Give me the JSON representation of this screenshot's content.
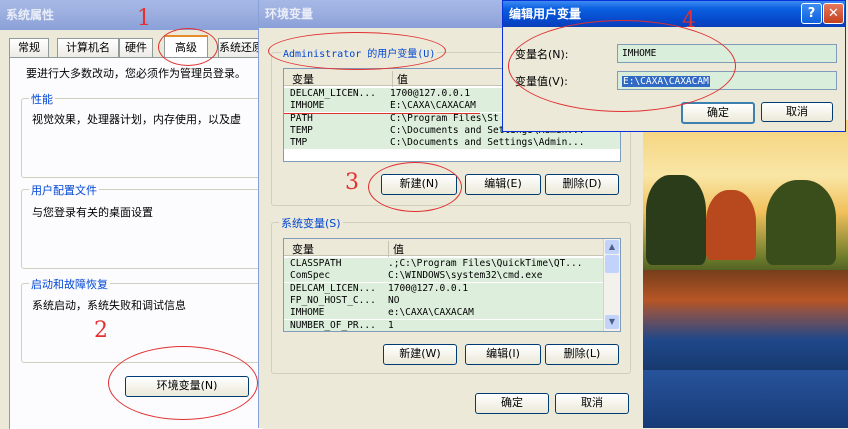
{
  "sys_props": {
    "title": "系统属性",
    "tabs": [
      "常规",
      "计算机名",
      "硬件",
      "高级",
      "系统还原"
    ],
    "intro": "要进行大多数改动，您必须作为管理员登录。",
    "perf": {
      "label": "性能",
      "text": "视觉效果，处理器计划，内存使用，以及虚"
    },
    "profile": {
      "label": "用户配置文件",
      "text": "与您登录有关的桌面设置"
    },
    "startup": {
      "label": "启动和故障恢复",
      "text": "系统启动，系统失败和调试信息"
    },
    "env_button": "环境变量(N)"
  },
  "env_vars": {
    "title": "环境变量",
    "user_group_label": "Administrator 的用户变量(U)",
    "col_var": "变量",
    "col_val": "值",
    "user_rows": [
      {
        "name": "DELCAM_LICEN...",
        "value": "1700@127.0.0.1"
      },
      {
        "name": "IMHOME",
        "value": "E:\\CAXA\\CAXACAM"
      },
      {
        "name": "PATH",
        "value": "C:\\Program Files\\St"
      },
      {
        "name": "TEMP",
        "value": "C:\\Documents and Settings\\Admin..."
      },
      {
        "name": "TMP",
        "value": "C:\\Documents and Settings\\Admin..."
      }
    ],
    "user_buttons": {
      "new": "新建(N)",
      "edit": "编辑(E)",
      "delete": "删除(D)"
    },
    "sys_group_label": "系统变量(S)",
    "sys_rows": [
      {
        "name": "CLASSPATH",
        "value": ".;C:\\Program Files\\QuickTime\\QT..."
      },
      {
        "name": "ComSpec",
        "value": "C:\\WINDOWS\\system32\\cmd.exe"
      },
      {
        "name": "DELCAM_LICEN...",
        "value": "1700@127.0.0.1"
      },
      {
        "name": "FP_NO_HOST_C...",
        "value": "NO"
      },
      {
        "name": "IMHOME",
        "value": "e:\\CAXA\\CAXACAM"
      },
      {
        "name": "NUMBER_OF_PR...",
        "value": "1"
      }
    ],
    "sys_buttons": {
      "new": "新建(W)",
      "edit": "编辑(I)",
      "delete": "删除(L)"
    },
    "ok": "确定",
    "cancel": "取消"
  },
  "edit_var": {
    "title": "编辑用户变量",
    "name_label": "变量名(N):",
    "name_value": "IMHOME",
    "value_label": "变量值(V):",
    "value_value": "E:\\CAXA\\CAXACAM",
    "ok": "确定",
    "cancel": "取消",
    "help_glyph": "?",
    "close_glyph": "✕"
  },
  "annotations": {
    "step1": "1",
    "step2": "2",
    "step3": "3",
    "step4": "4"
  },
  "colors": {
    "annotation": "#e03030",
    "title_active": "#0a5fe0",
    "group_label": "#0046d5"
  }
}
